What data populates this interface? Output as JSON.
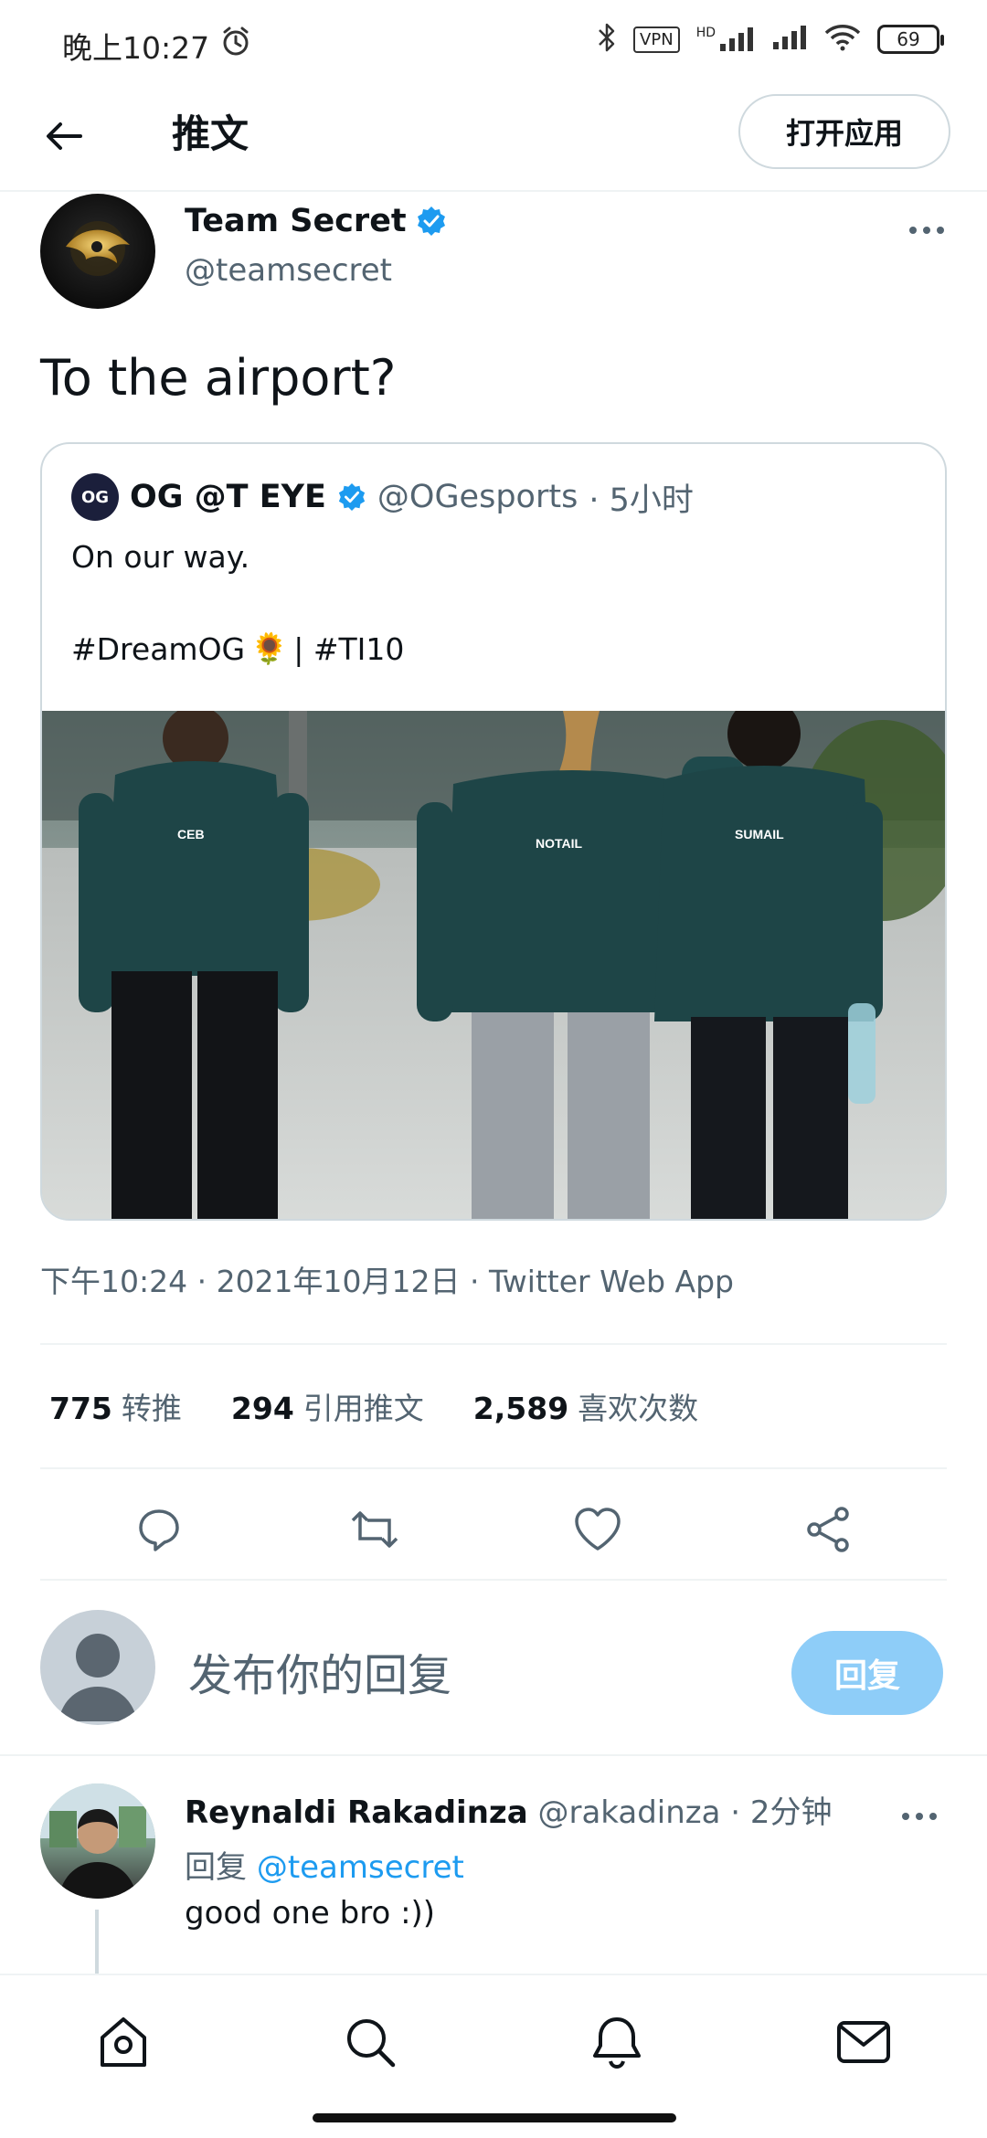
{
  "status_bar": {
    "time": "晚上10:27",
    "vpn": "VPN",
    "network": "HD",
    "battery": "69",
    "icons": [
      "alarm-icon",
      "bluetooth-icon",
      "signal-icon",
      "wifi-icon",
      "battery-icon"
    ]
  },
  "header": {
    "title": "推文",
    "open_app": "打开应用",
    "back_icon": "arrow-left-icon"
  },
  "tweet": {
    "author_name": "Team Secret",
    "author_handle": "@teamsecret",
    "verified": true,
    "text": "To the airport?",
    "timestamp": "下午10:24 · 2021年10月12日 · Twitter Web App",
    "stats": [
      {
        "value": "775",
        "label": "转推"
      },
      {
        "value": "294",
        "label": "引用推文"
      },
      {
        "value": "2,589",
        "label": "喜欢次数"
      }
    ],
    "actions": [
      "reply-icon",
      "retweet-icon",
      "like-icon",
      "share-icon"
    ]
  },
  "quote": {
    "avatar_text": "OG",
    "name": "OG @T EYE",
    "handle": "@OGesports",
    "time": "· 5小时",
    "line1": "On our way.",
    "hashtag1": "#DreamOG",
    "emoji": "🌻",
    "line2_rest": "| #TI10",
    "photo_labels": [
      "CEB",
      "NOTAIL",
      "SUMAIL"
    ]
  },
  "composer": {
    "placeholder": "发布你的回复",
    "button": "回复"
  },
  "reply": {
    "name": "Reynaldi Rakadinza",
    "handle": "@rakadinza",
    "time": "· 2分钟",
    "reply_prefix": "回复",
    "reply_to": "@teamsecret",
    "text": "good one bro :))"
  },
  "bottom_nav": [
    "home-icon",
    "search-icon",
    "notifications-icon",
    "messages-icon"
  ],
  "colors": {
    "accent": "#1d9bf0",
    "reply_button": "#8ecdf8",
    "secondary_text": "#536471",
    "border": "#eff3f4"
  }
}
